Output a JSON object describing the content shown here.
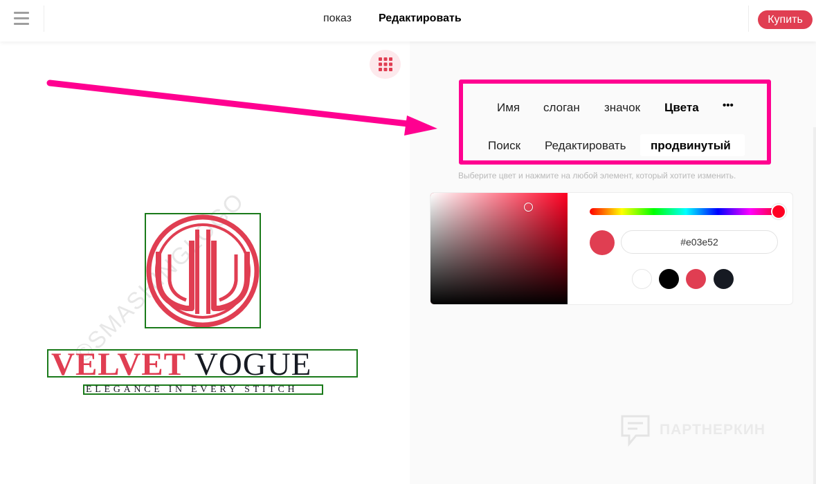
{
  "header": {
    "nav": [
      "показ",
      "Редактировать"
    ],
    "buy_label": "Купить"
  },
  "canvas": {
    "brand_word1": "VELVET",
    "brand_word2": "VOGUE",
    "slogan": "ELEGANCE IN EVERY STITCH",
    "watermark": "©SMASHINGLOGO"
  },
  "panel": {
    "tabs_row1": [
      "Имя",
      "слоган",
      "значок",
      "Цвета",
      "•••"
    ],
    "tabs_row2": [
      "Поиск",
      "Редактировать",
      "продвинутый"
    ],
    "hint": "Выберите цвет и нажмите на любой элемент, который хотите изменить.",
    "hex_value": "#e03e52",
    "watermark": "ПАРТНЕРКИН"
  },
  "colors": {
    "accent": "#e03e52",
    "dark": "#161a22",
    "highlight": "#ff0090",
    "selection_outline": "#1a7a1a",
    "swatches": [
      "#ffffff",
      "#000000",
      "#e03e52",
      "#161a22"
    ]
  }
}
